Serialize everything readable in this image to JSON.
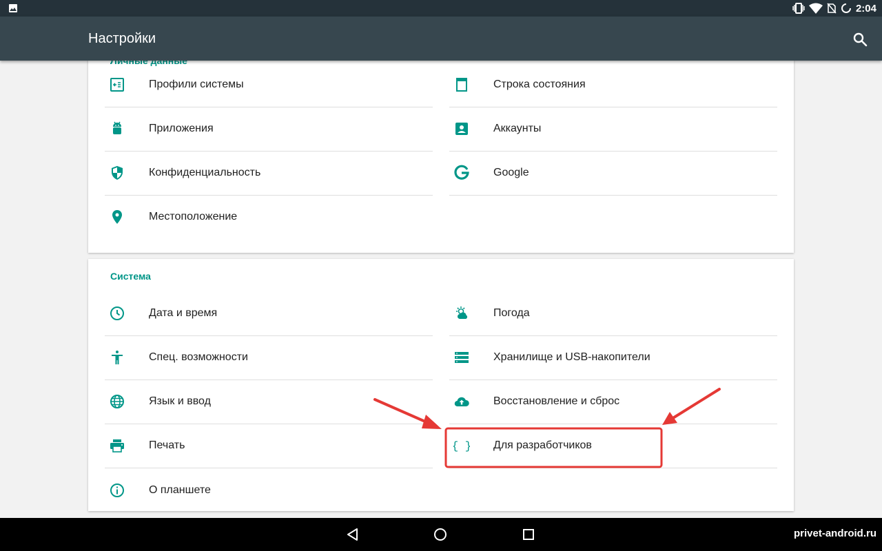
{
  "status_bar": {
    "time": "2:04",
    "icons": [
      "image-icon",
      "vibrate-icon",
      "wifi-icon",
      "no-sim-icon",
      "loading-icon"
    ]
  },
  "app_bar": {
    "title": "Настройки",
    "search_icon": "search-icon"
  },
  "categories": [
    {
      "title": "Личные данные",
      "items": [
        {
          "label": "Профили системы",
          "icon": "profiles-icon"
        },
        {
          "label": "Строка состояния",
          "icon": "statusbar-icon"
        },
        {
          "label": "Приложения",
          "icon": "android-icon"
        },
        {
          "label": "Аккаунты",
          "icon": "account-icon"
        },
        {
          "label": "Конфиденциальность",
          "icon": "shield-icon"
        },
        {
          "label": "Google",
          "icon": "google-icon"
        },
        {
          "label": "Местоположение",
          "icon": "location-pin-icon"
        }
      ]
    },
    {
      "title": "Система",
      "items": [
        {
          "label": "Дата и время",
          "icon": "clock-icon"
        },
        {
          "label": "Погода",
          "icon": "weather-icon"
        },
        {
          "label": "Спец. возможности",
          "icon": "accessibility-icon"
        },
        {
          "label": "Хранилище и USB-накопители",
          "icon": "storage-icon"
        },
        {
          "label": "Язык и ввод",
          "icon": "globe-icon"
        },
        {
          "label": "Восстановление и сброс",
          "icon": "cloud-upload-icon"
        },
        {
          "label": "Печать",
          "icon": "printer-icon"
        },
        {
          "label": "Для разработчиков",
          "icon": "braces-icon"
        },
        {
          "label": "О планшете",
          "icon": "info-icon"
        }
      ]
    }
  ],
  "nav_bar": {
    "buttons": [
      "back-icon",
      "home-icon",
      "recents-icon"
    ]
  },
  "watermark": "privet-android.ru",
  "colors": {
    "accent": "#009688",
    "app_bar": "#37474f",
    "status_bar": "#25323a",
    "highlight": "#e53935"
  }
}
